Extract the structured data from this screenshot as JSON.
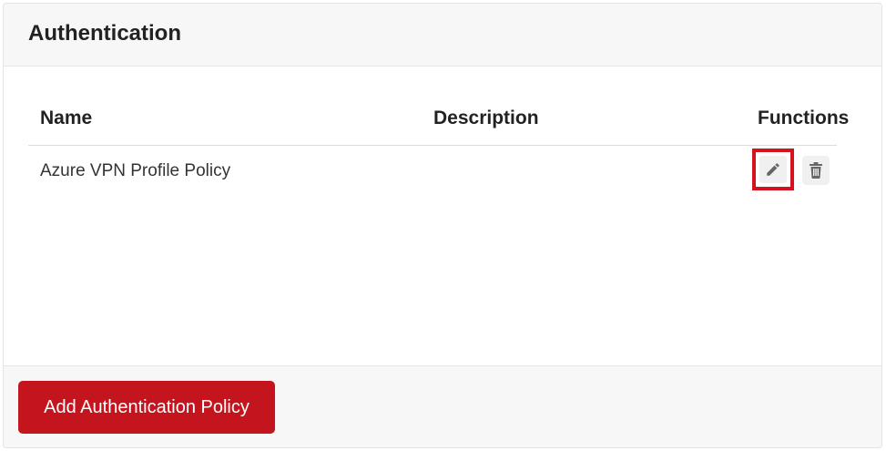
{
  "panel": {
    "title": "Authentication"
  },
  "table": {
    "columns": {
      "name": "Name",
      "description": "Description",
      "functions": "Functions"
    },
    "rows": [
      {
        "name": "Azure VPN Profile Policy",
        "description": "",
        "actions": [
          "pencil-icon",
          "trash-icon"
        ]
      }
    ]
  },
  "footer": {
    "add_button_label": "Add Authentication Policy"
  },
  "colors": {
    "accent": "#c4151e",
    "highlight": "#d4131e",
    "header_bg": "#f7f7f7"
  }
}
